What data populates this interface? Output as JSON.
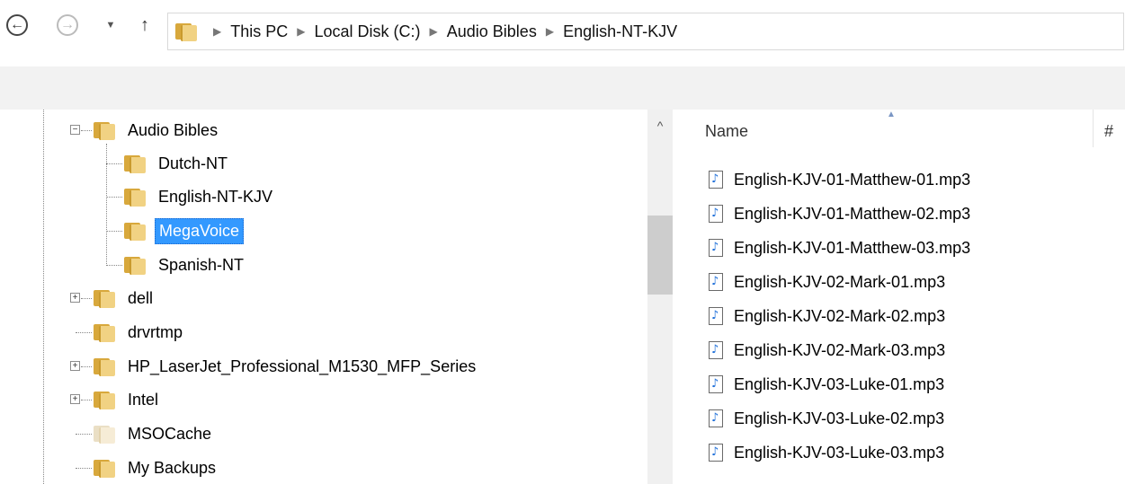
{
  "breadcrumb": [
    "This PC",
    "Local Disk (C:)",
    "Audio Bibles",
    "English-NT-KJV"
  ],
  "tree": {
    "items": [
      {
        "label": "Audio Bibles",
        "expander": "−",
        "level": 1
      },
      {
        "label": "Dutch-NT",
        "level": 2
      },
      {
        "label": "English-NT-KJV",
        "level": 2
      },
      {
        "label": "MegaVoice",
        "level": 2,
        "selected": true
      },
      {
        "label": "Spanish-NT",
        "level": 2
      },
      {
        "label": "dell",
        "expander": "+",
        "level": 1
      },
      {
        "label": "drvrtmp",
        "level": 1
      },
      {
        "label": "HP_LaserJet_Professional_M1530_MFP_Series",
        "expander": "+",
        "level": 1
      },
      {
        "label": "Intel",
        "expander": "+",
        "level": 1
      },
      {
        "label": "MSOCache",
        "level": 1,
        "faded": true
      },
      {
        "label": "My Backups",
        "level": 1
      }
    ]
  },
  "list": {
    "col_name": "Name",
    "col_hash": "#",
    "files": [
      "English-KJV-01-Matthew-01.mp3",
      "English-KJV-01-Matthew-02.mp3",
      "English-KJV-01-Matthew-03.mp3",
      "English-KJV-02-Mark-01.mp3",
      "English-KJV-02-Mark-02.mp3",
      "English-KJV-02-Mark-03.mp3",
      "English-KJV-03-Luke-01.mp3",
      "English-KJV-03-Luke-02.mp3",
      "English-KJV-03-Luke-03.mp3"
    ]
  },
  "icons": {
    "back": "back-arrow-icon",
    "forward": "forward-arrow-icon",
    "recent": "chevron-down-icon",
    "up": "up-arrow-icon",
    "folder": "folder-icon",
    "audio_file": "audio-file-icon"
  },
  "colors": {
    "selection": "#3399ff",
    "folder": "#f1d283",
    "music_note": "#1e6fd9"
  }
}
